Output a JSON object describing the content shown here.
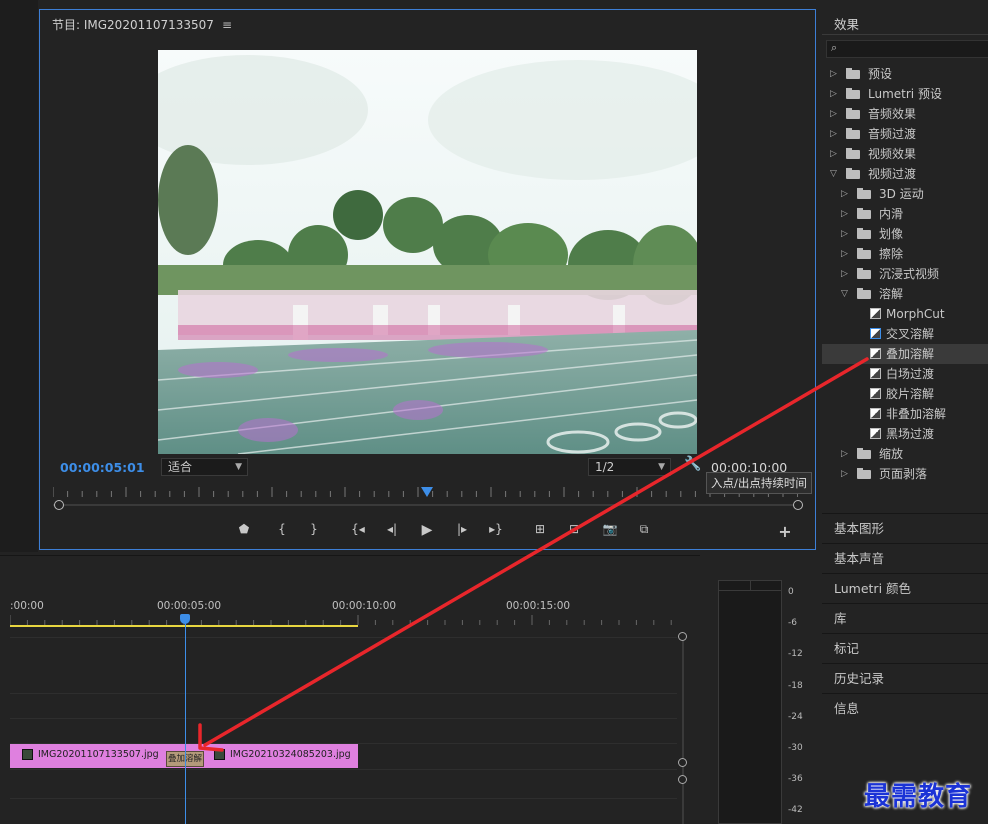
{
  "monitor": {
    "title": "节目: IMG20201107133507",
    "menu_icon": "≡",
    "timecode_current": "00:00:05:01",
    "fit_label": "适合",
    "resolution_label": "1/2",
    "timecode_duration": "00:00:10:00",
    "tooltip": "入点/出点持续时间"
  },
  "transport_icons": [
    "marker-icon",
    "mark-in-icon",
    "mark-out-icon",
    "go-to-in-icon",
    "step-back-icon",
    "play-icon",
    "step-forward-icon",
    "go-to-out-icon",
    "lift-icon",
    "extract-icon",
    "export-frame-icon",
    "compare-icon",
    "add-button-icon"
  ],
  "effects": {
    "tab_label": "效果",
    "tree": [
      {
        "label": "预设",
        "level": 0,
        "kind": "folder-star"
      },
      {
        "label": "Lumetri 预设",
        "level": 0,
        "kind": "folder-star"
      },
      {
        "label": "音频效果",
        "level": 0,
        "kind": "folder"
      },
      {
        "label": "音频过渡",
        "level": 0,
        "kind": "folder"
      },
      {
        "label": "视频效果",
        "level": 0,
        "kind": "folder"
      },
      {
        "label": "视频过渡",
        "level": 0,
        "kind": "folder-open"
      },
      {
        "label": "3D 运动",
        "level": 1,
        "kind": "folder"
      },
      {
        "label": "内滑",
        "level": 1,
        "kind": "folder"
      },
      {
        "label": "划像",
        "level": 1,
        "kind": "folder"
      },
      {
        "label": "擦除",
        "level": 1,
        "kind": "folder"
      },
      {
        "label": "沉浸式视频",
        "level": 1,
        "kind": "folder"
      },
      {
        "label": "溶解",
        "level": 1,
        "kind": "folder-open"
      },
      {
        "label": "MorphCut",
        "level": 2,
        "kind": "fx"
      },
      {
        "label": "交叉溶解",
        "level": 2,
        "kind": "fx-hl"
      },
      {
        "label": "叠加溶解",
        "level": 2,
        "kind": "fx",
        "selected": true
      },
      {
        "label": "白场过渡",
        "level": 2,
        "kind": "fx"
      },
      {
        "label": "胶片溶解",
        "level": 2,
        "kind": "fx"
      },
      {
        "label": "非叠加溶解",
        "level": 2,
        "kind": "fx"
      },
      {
        "label": "黑场过渡",
        "level": 2,
        "kind": "fx"
      },
      {
        "label": "缩放",
        "level": 1,
        "kind": "folder"
      },
      {
        "label": "页面剥落",
        "level": 1,
        "kind": "folder"
      }
    ],
    "panels": [
      "基本图形",
      "基本声音",
      "Lumetri 颜色",
      "库",
      "标记",
      "历史记录",
      "信息"
    ]
  },
  "timeline": {
    "tick_labels": [
      ":00:00",
      "00:00:05:00",
      "00:00:10:00",
      "00:00:15:00"
    ],
    "clip1_label": "IMG20201107133507.jpg",
    "clip2_label": "IMG20210324085203.jpg",
    "transition_label": "叠加溶解"
  },
  "meter_labels": [
    "0",
    "-6",
    "-12",
    "-18",
    "-24",
    "-30",
    "-36",
    "-42"
  ],
  "watermark": "最需教育"
}
